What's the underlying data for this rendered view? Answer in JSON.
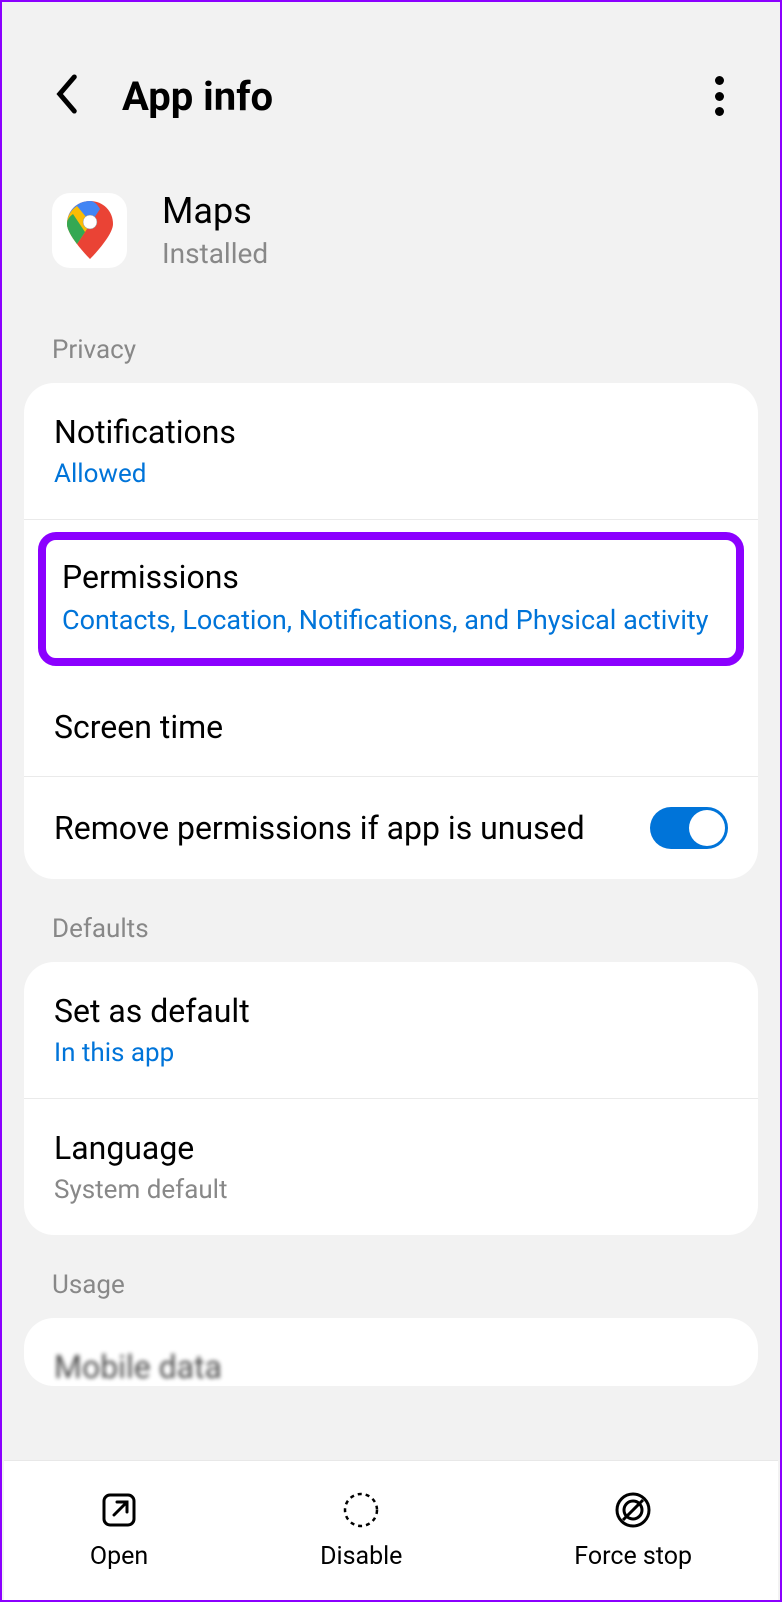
{
  "header": {
    "title": "App info"
  },
  "app": {
    "name": "Maps",
    "status": "Installed"
  },
  "sections": {
    "privacy": {
      "label": "Privacy",
      "notifications": {
        "title": "Notifications",
        "value": "Allowed"
      },
      "permissions": {
        "title": "Permissions",
        "value": "Contacts, Location, Notifications, and Physical activity"
      },
      "screentime": {
        "title": "Screen time"
      },
      "remove_perms": {
        "title": "Remove permissions if app is unused",
        "toggle": true
      }
    },
    "defaults": {
      "label": "Defaults",
      "set_default": {
        "title": "Set as default",
        "value": "In this app"
      },
      "language": {
        "title": "Language",
        "value": "System default"
      }
    },
    "usage": {
      "label": "Usage",
      "mobile_data": {
        "title": "Mobile data"
      }
    }
  },
  "bottom_nav": {
    "open": "Open",
    "disable": "Disable",
    "force_stop": "Force stop"
  }
}
